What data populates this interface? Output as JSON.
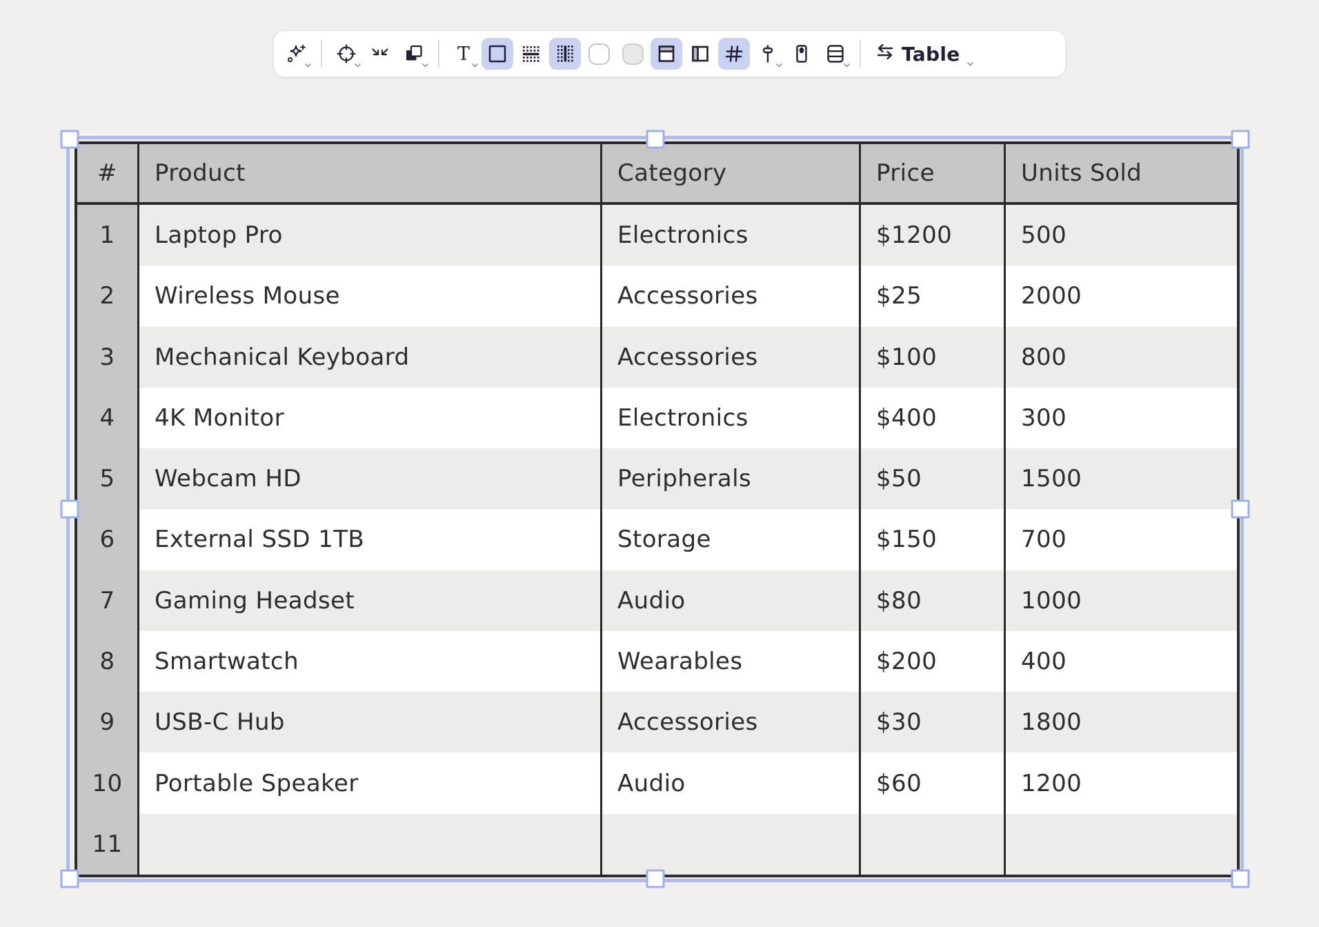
{
  "colors": {
    "canvas_bg": "#f1f0ef",
    "icon_ink": "#241f35",
    "toolbar_active_bg": "#c9d2f3",
    "header_bg": "#c7c7c7",
    "stripe_bg": "#ececeb",
    "row_bg": "#ffffff",
    "table_border": "#2a2a2a",
    "cell_text": "#2e2d2b",
    "selection_blue": "#aebbee",
    "selection_handle_border": "#9dafec"
  },
  "toolbar": {
    "buttons": [
      {
        "name": "ai-style",
        "icon": "sparkle-plus-icon",
        "active": false,
        "chevron": true
      },
      {
        "name": "stroke-style",
        "icon": "target-circle-icon",
        "active": false,
        "chevron": true
      },
      {
        "name": "shrink",
        "icon": "shrink-arrows-icon",
        "active": false,
        "chevron": false
      },
      {
        "name": "shape-style",
        "icon": "overlapping-squares-icon",
        "active": false,
        "chevron": true
      },
      {
        "name": "text-style",
        "icon": "serif-t-icon",
        "active": false,
        "chevron": true
      },
      {
        "name": "outer-border-toggle",
        "icon": "square-outline-icon",
        "active": true,
        "chevron": false
      },
      {
        "name": "row-borders-toggle",
        "icon": "dotted-row-border-icon",
        "active": false,
        "chevron": false
      },
      {
        "name": "column-borders-toggle",
        "icon": "dotted-column-border-icon",
        "active": true,
        "chevron": false
      },
      {
        "name": "swatch-white",
        "icon": "white-squircle-swatch",
        "active": false,
        "chevron": false
      },
      {
        "name": "swatch-gray",
        "icon": "gray-squircle-swatch",
        "active": false,
        "chevron": false
      },
      {
        "name": "header-row-toggle",
        "icon": "table-header-row-icon",
        "active": true,
        "chevron": false
      },
      {
        "name": "header-column-toggle",
        "icon": "table-header-column-icon",
        "active": false,
        "chevron": false
      },
      {
        "name": "row-numbers-toggle",
        "icon": "hash-icon",
        "active": true,
        "chevron": false
      },
      {
        "name": "size-adjust",
        "icon": "vertical-slider-icon",
        "active": false,
        "chevron": true
      },
      {
        "name": "cell-padding",
        "icon": "pill-dot-icon",
        "active": false,
        "chevron": false
      },
      {
        "name": "row-height",
        "icon": "stacked-rows-icon",
        "active": false,
        "chevron": true
      }
    ],
    "convert": {
      "label": "Table",
      "icon": "swap-arrows-icon",
      "chevron": true
    }
  },
  "table": {
    "headers": [
      "#",
      "Product",
      "Category",
      "Price",
      "Units Sold"
    ],
    "rows": [
      {
        "num": "1",
        "product": "Laptop Pro",
        "category": "Electronics",
        "price": "$1200",
        "units": "500"
      },
      {
        "num": "2",
        "product": "Wireless Mouse",
        "category": "Accessories",
        "price": "$25",
        "units": "2000"
      },
      {
        "num": "3",
        "product": "Mechanical Keyboard",
        "category": "Accessories",
        "price": "$100",
        "units": "800"
      },
      {
        "num": "4",
        "product": "4K Monitor",
        "category": "Electronics",
        "price": "$400",
        "units": "300"
      },
      {
        "num": "5",
        "product": "Webcam HD",
        "category": "Peripherals",
        "price": "$50",
        "units": "1500"
      },
      {
        "num": "6",
        "product": "External SSD 1TB",
        "category": "Storage",
        "price": "$150",
        "units": "700"
      },
      {
        "num": "7",
        "product": "Gaming Headset",
        "category": "Audio",
        "price": "$80",
        "units": "1000"
      },
      {
        "num": "8",
        "product": "Smartwatch",
        "category": "Wearables",
        "price": "$200",
        "units": "400"
      },
      {
        "num": "9",
        "product": "USB-C Hub",
        "category": "Accessories",
        "price": "$30",
        "units": "1800"
      },
      {
        "num": "10",
        "product": "Portable Speaker",
        "category": "Audio",
        "price": "$60",
        "units": "1200"
      },
      {
        "num": "11",
        "product": "",
        "category": "",
        "price": "",
        "units": ""
      }
    ]
  },
  "selection": {
    "handle_count": 8
  }
}
